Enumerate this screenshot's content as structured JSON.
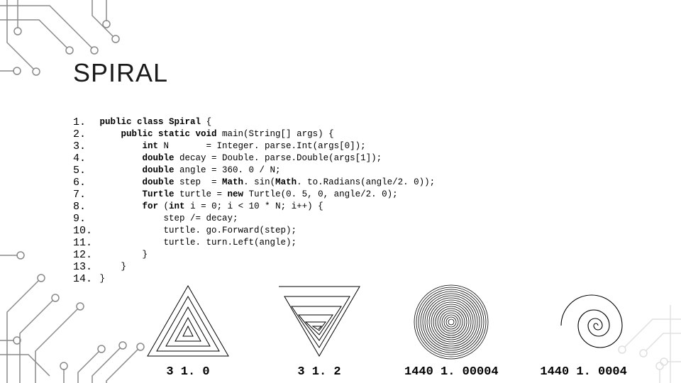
{
  "title": "SPIRAL",
  "code": {
    "lines": [
      {
        "n": "1.",
        "tokens": [
          {
            "kw": true,
            "t": "public class "
          },
          {
            "kw": true,
            "t": "Spiral"
          },
          {
            "kw": false,
            "t": " {"
          }
        ]
      },
      {
        "n": "2.",
        "indent": 4,
        "tokens": [
          {
            "kw": true,
            "t": "public static void "
          },
          {
            "kw": false,
            "t": "main(String[] args) {"
          }
        ]
      },
      {
        "n": "3.",
        "indent": 8,
        "tokens": [
          {
            "kw": true,
            "t": "int "
          },
          {
            "kw": false,
            "t": "N       = Integer. parse.Int(args[0]);"
          }
        ]
      },
      {
        "n": "4.",
        "indent": 8,
        "tokens": [
          {
            "kw": true,
            "t": "double "
          },
          {
            "kw": false,
            "t": "decay = Double. parse.Double(args[1]);"
          }
        ]
      },
      {
        "n": "5.",
        "indent": 8,
        "tokens": [
          {
            "kw": true,
            "t": "double "
          },
          {
            "kw": false,
            "t": "angle = 360. 0 / N;"
          }
        ]
      },
      {
        "n": "6.",
        "indent": 8,
        "tokens": [
          {
            "kw": true,
            "t": "double "
          },
          {
            "kw": false,
            "t": "step  = "
          },
          {
            "kw": true,
            "t": "Math"
          },
          {
            "kw": false,
            "t": ". sin("
          },
          {
            "kw": true,
            "t": "Math"
          },
          {
            "kw": false,
            "t": ". to.Radians(angle/2. 0));"
          }
        ]
      },
      {
        "n": "7.",
        "indent": 8,
        "tokens": [
          {
            "kw": true,
            "t": "Turtle "
          },
          {
            "kw": false,
            "t": "turtle = "
          },
          {
            "kw": true,
            "t": "new "
          },
          {
            "kw": false,
            "t": "Turtle(0. 5, 0, angle/2. 0);"
          }
        ]
      },
      {
        "n": "8.",
        "indent": 8,
        "tokens": [
          {
            "kw": true,
            "t": "for "
          },
          {
            "kw": false,
            "t": "("
          },
          {
            "kw": true,
            "t": "int "
          },
          {
            "kw": false,
            "t": "i = 0; i < 10 * N; i++) {"
          }
        ]
      },
      {
        "n": "9.",
        "indent": 12,
        "tokens": [
          {
            "kw": false,
            "t": "step /= decay;"
          }
        ]
      },
      {
        "n": "10.",
        "indent": 12,
        "tokens": [
          {
            "kw": false,
            "t": "turtle. go.Forward(step);"
          }
        ]
      },
      {
        "n": "11.",
        "indent": 12,
        "tokens": [
          {
            "kw": false,
            "t": "turtle. turn.Left(angle);"
          }
        ]
      },
      {
        "n": "12.",
        "indent": 8,
        "tokens": [
          {
            "kw": false,
            "t": "}"
          }
        ]
      },
      {
        "n": "13.",
        "indent": 4,
        "tokens": [
          {
            "kw": false,
            "t": "}"
          }
        ]
      },
      {
        "n": "14.",
        "indent": 0,
        "tokens": [
          {
            "kw": false,
            "t": "}"
          }
        ]
      }
    ]
  },
  "examples": [
    {
      "caption": "3 1. 0"
    },
    {
      "caption": "3 1. 2"
    },
    {
      "caption": "1440 1. 00004"
    },
    {
      "caption": "1440 1. 0004"
    }
  ]
}
